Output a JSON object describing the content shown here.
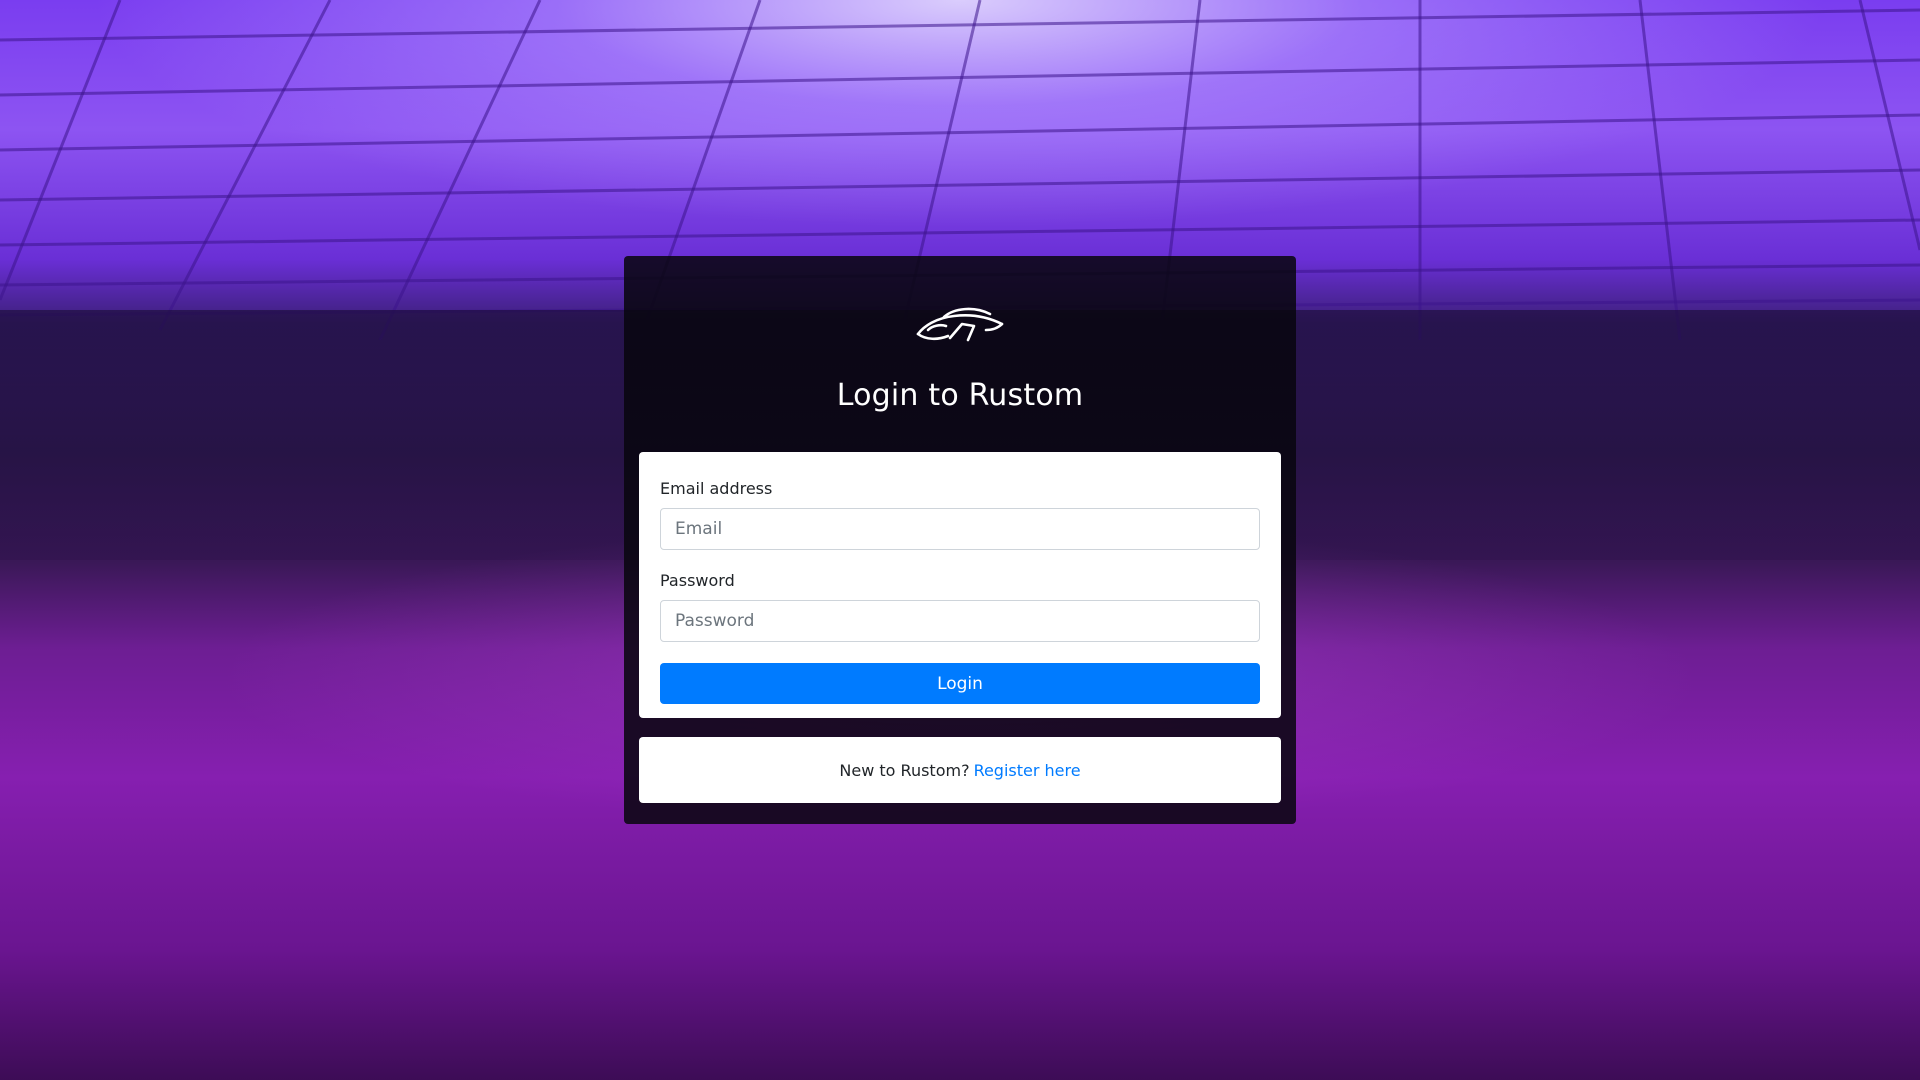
{
  "page": {
    "title": "Login to Rustom",
    "logo_icon": "sports-car-icon"
  },
  "form": {
    "email_label": "Email address",
    "email_placeholder": "Email",
    "email_value": "",
    "password_label": "Password",
    "password_placeholder": "Password",
    "password_value": "",
    "submit_label": "Login"
  },
  "register": {
    "prompt": "New to Rustom?",
    "link_label": "Register here"
  },
  "colors": {
    "accent": "#007bff",
    "card_background": "#0a0810",
    "background_theme": "#7a2fd0"
  }
}
